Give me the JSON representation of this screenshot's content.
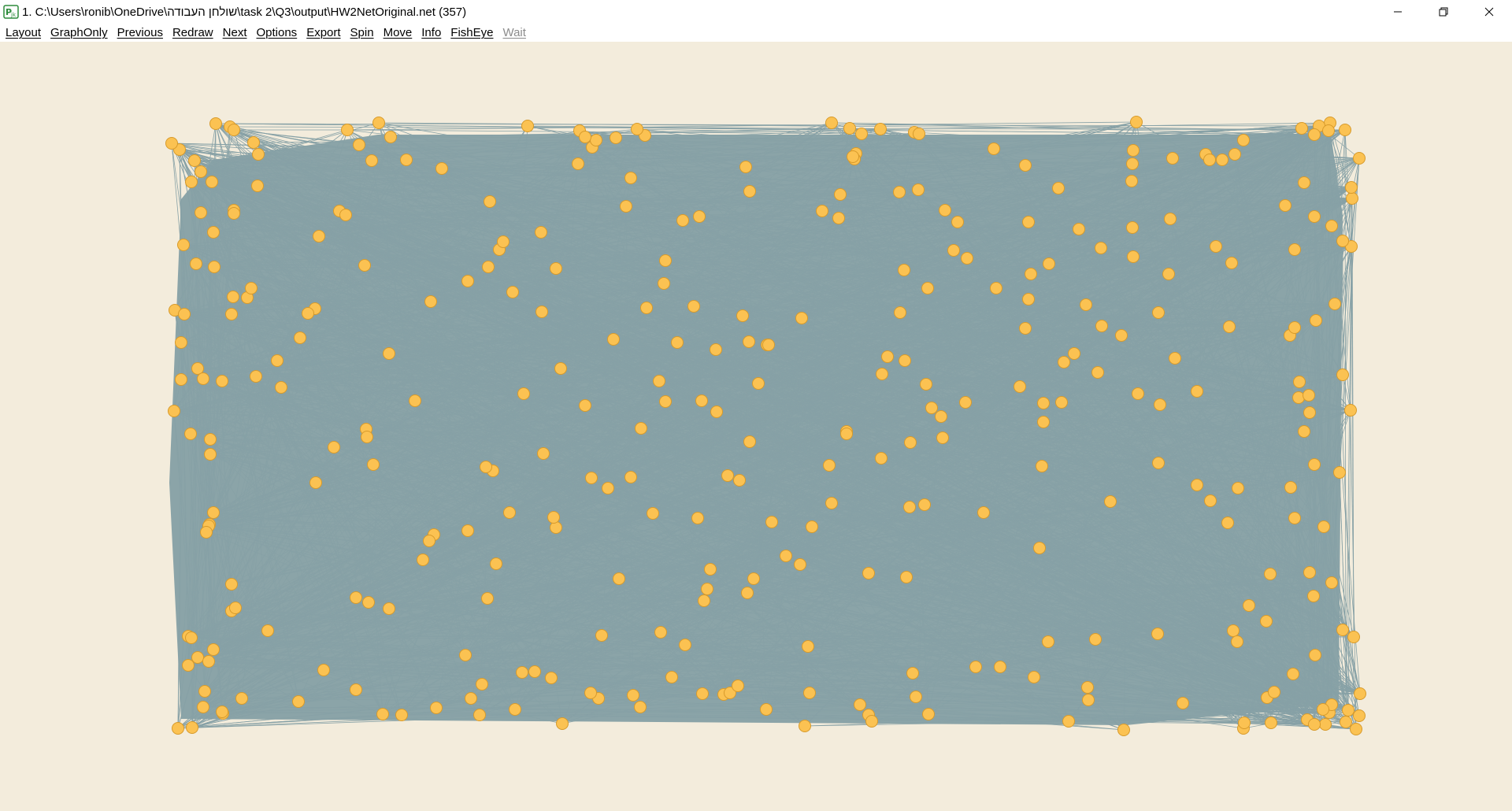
{
  "window": {
    "title": "1. C:\\Users\\ronib\\OneDrive\\שולחן העבודה\\task 2\\Q3\\output\\HW2NetOriginal.net (357)",
    "controls": [
      "minimize-icon",
      "restore-icon",
      "close-icon"
    ]
  },
  "menu": {
    "items": [
      {
        "label": "Layout",
        "enabled": true
      },
      {
        "label": "GraphOnly",
        "enabled": true
      },
      {
        "label": "Previous",
        "enabled": true
      },
      {
        "label": "Redraw",
        "enabled": true
      },
      {
        "label": "Next",
        "enabled": true
      },
      {
        "label": "Options",
        "enabled": true
      },
      {
        "label": "Export",
        "enabled": true
      },
      {
        "label": "Spin",
        "enabled": true
      },
      {
        "label": "Move",
        "enabled": true
      },
      {
        "label": "Info",
        "enabled": true
      },
      {
        "label": "FishEye",
        "enabled": true
      },
      {
        "label": "Wait",
        "enabled": false
      }
    ]
  },
  "network": {
    "node_count": 357,
    "node_color": "#fbc252",
    "node_stroke": "#d79a2b",
    "edge_color": "#87a1a6",
    "background": "#f3ecdc"
  }
}
